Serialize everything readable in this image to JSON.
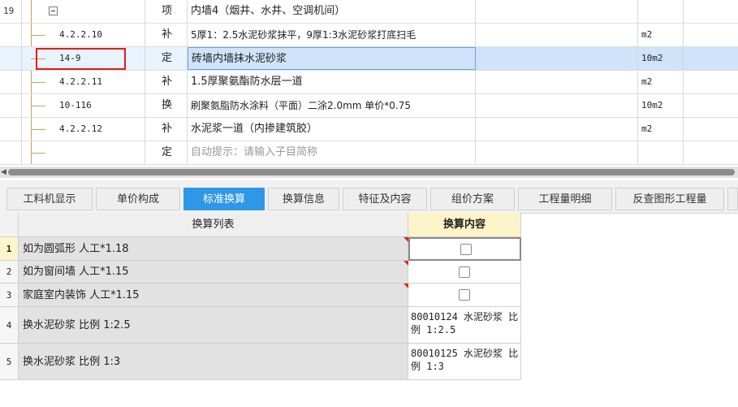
{
  "rows": [
    {
      "num": "19",
      "code": "",
      "type": "项",
      "name": "内墙4（烟井、水井、空调机间）",
      "unit": ""
    },
    {
      "num": "",
      "code": "4.2.2.10",
      "type": "补",
      "name": "5厚1：2.5水泥砂浆抹平，9厚1:3水泥砂浆打底扫毛",
      "unit": "m2"
    },
    {
      "num": "",
      "code": "14-9",
      "type": "定",
      "name": "砖墙内墙抹水泥砂浆",
      "unit": "10m2"
    },
    {
      "num": "",
      "code": "4.2.2.11",
      "type": "补",
      "name": "1.5厚聚氨酯防水层一道",
      "unit": "m2"
    },
    {
      "num": "",
      "code": "10-116",
      "type": "换",
      "name": "刷聚氨脂防水涂料（平面）二涂2.0mm  单价*0.75",
      "unit": "10m2"
    },
    {
      "num": "",
      "code": "4.2.2.12",
      "type": "补",
      "name": "水泥浆一道（内掺建筑胶）",
      "unit": "m2"
    },
    {
      "num": "",
      "code": "",
      "type": "定",
      "name": "自动提示：请输入子目简称",
      "unit": ""
    }
  ],
  "ellipsis": "···",
  "tabs": [
    "工料机显示",
    "单价构成",
    "标准换算",
    "换算信息",
    "特征及内容",
    "组价方案",
    "工程量明细",
    "反查图形工程量"
  ],
  "active_tab": "标准换算",
  "lower": {
    "col_list": "换算列表",
    "col_content": "换算内容",
    "items": [
      {
        "num": "1",
        "text": "如为圆弧形 人工*1.18",
        "content": ""
      },
      {
        "num": "2",
        "text": "如为窗间墙 人工*1.15",
        "content": ""
      },
      {
        "num": "3",
        "text": "家庭室内装饰 人工*1.15",
        "content": ""
      },
      {
        "num": "4",
        "text": "换水泥砂浆 比例 1:2.5",
        "content": "80010124  水泥砂浆 比例 1:2.5"
      },
      {
        "num": "5",
        "text": "换水泥砂浆 比例 1:3",
        "content": "80010125  水泥砂浆 比例 1:3"
      }
    ]
  },
  "colors": {
    "accent": "#2f97e8",
    "highlight_border": "#e31b1b",
    "selected_row": "#cfe3fa"
  }
}
